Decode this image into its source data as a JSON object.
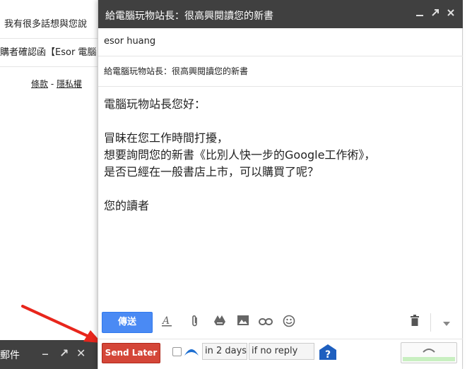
{
  "background": {
    "row1_text": "我有很多話想與您說",
    "row2_text": "購者確認函【Esor 電腦",
    "links": {
      "terms": "條款",
      "separator": " - ",
      "privacy": "隱私權"
    }
  },
  "minimized_compose": {
    "title": "新郵件",
    "controls": {
      "minimize": "_",
      "popout": "↗",
      "close": "✕"
    }
  },
  "compose": {
    "title": "給電腦玩物站長：很高興閱讀您的新書",
    "controls": {
      "minimize": "_",
      "popout": "↗",
      "close": "✕"
    },
    "to": "esor huang",
    "subject": "給電腦玩物站長：很高興閱讀您的新書",
    "body_lines": [
      "電腦玩物站長您好：",
      "",
      "冒昧在您工作時間打擾，",
      "想要詢問您的新書《比別人快一步的Google工作術》，",
      "是否已經在一般書店上市，可以購買了呢？",
      "",
      "您的讀者"
    ],
    "toolbar": {
      "send_label": "傳送",
      "icons": {
        "format": "format-text-icon",
        "attach": "paperclip-icon",
        "drive": "drive-icon",
        "photo": "photo-icon",
        "link": "link-icon",
        "emoji": "emoji-icon",
        "trash": "trash-icon",
        "more": "chevron-down-icon"
      }
    },
    "boomerang": {
      "send_later_label": "Send Later",
      "checked": false,
      "delay_value": "in 2 days",
      "condition_value": "if no reply",
      "help_glyph": "?"
    }
  },
  "colors": {
    "title_bar": "#404040",
    "send_button": "#4a8af4",
    "send_later_button": "#d44638",
    "arrow": "#e8261c",
    "boomerang_blue": "#1e6fd1"
  }
}
